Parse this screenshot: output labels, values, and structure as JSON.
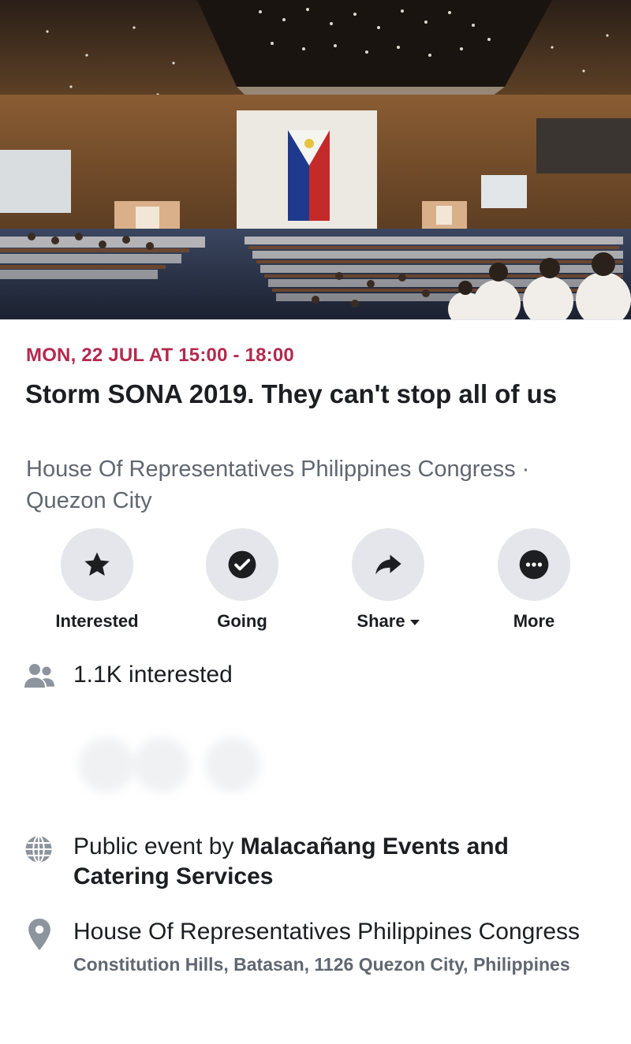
{
  "event": {
    "date": "MON, 22 JUL AT 15:00 - 18:00",
    "title": "Storm SONA 2019. They can't stop all of us",
    "venue_line": "House Of Representatives Philippines Congress · Quezon City",
    "cover_photo": "session-hall-photo"
  },
  "actions": [
    {
      "label": "Interested",
      "icon": "star-icon"
    },
    {
      "label": "Going",
      "icon": "check-circle-icon"
    },
    {
      "label": "Share",
      "icon": "share-arrow-icon",
      "has_dropdown": true
    },
    {
      "label": "More",
      "icon": "more-dots-icon"
    }
  ],
  "interested": {
    "text": "1.1K interested",
    "icon": "people-icon"
  },
  "public": {
    "prefix": "Public event by ",
    "host": "Malacañang Events and Catering Services",
    "icon": "globe-icon"
  },
  "location": {
    "name": "House Of Representatives Philippines Congress",
    "address": "Constitution Hills, Batasan, 1126 Quezon City, Philippines",
    "icon": "location-pin-icon"
  },
  "colors": {
    "date_accent": "#b4294e",
    "circle_bg": "#e4e6eb",
    "secondary_text": "#606770"
  }
}
